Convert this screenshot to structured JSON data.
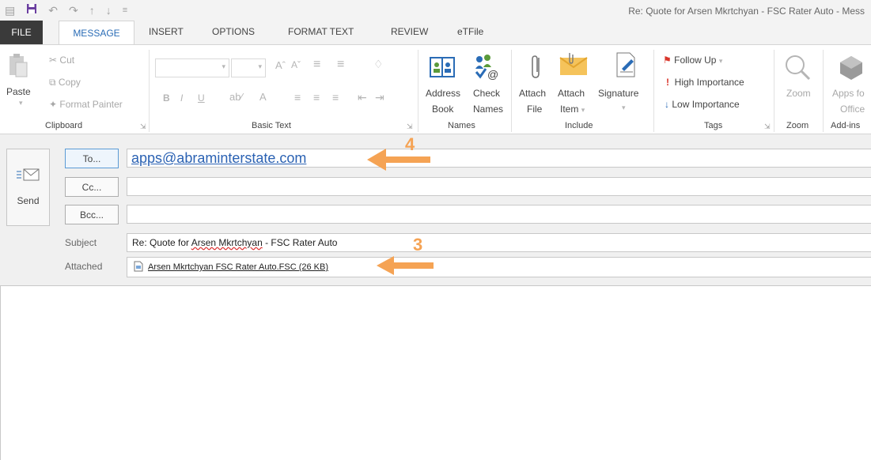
{
  "window": {
    "title": "Re: Quote for Arsen Mkrtchyan - FSC Rater Auto - Mess"
  },
  "tabs": {
    "file": "FILE",
    "message": "MESSAGE",
    "insert": "INSERT",
    "options": "OPTIONS",
    "format_text": "FORMAT TEXT",
    "review": "REVIEW",
    "etfile": "eTFile"
  },
  "ribbon": {
    "clipboard": {
      "paste": "Paste",
      "cut": "Cut",
      "copy": "Copy",
      "format_painter": "Format Painter",
      "label": "Clipboard"
    },
    "basic_text": {
      "label": "Basic Text",
      "bold": "B",
      "italic": "I",
      "underline": "U"
    },
    "names": {
      "address_book_1": "Address",
      "address_book_2": "Book",
      "check_names_1": "Check",
      "check_names_2": "Names",
      "label": "Names"
    },
    "include": {
      "attach_file_1": "Attach",
      "attach_file_2": "File",
      "attach_item_1": "Attach",
      "attach_item_2": "Item",
      "signature": "Signature",
      "label": "Include"
    },
    "tags": {
      "follow_up": "Follow Up",
      "high_importance": "High Importance",
      "low_importance": "Low Importance",
      "label": "Tags"
    },
    "zoom": {
      "zoom": "Zoom",
      "label": "Zoom"
    },
    "addins": {
      "apps_1": "Apps fo",
      "apps_2": "Office",
      "label": "Add-ins"
    }
  },
  "compose": {
    "send": "Send",
    "to_button": "To...",
    "cc_button": "Cc...",
    "bcc_button": "Bcc...",
    "to_value": "apps@abraminterstate.com",
    "subject_label": "Subject",
    "subject_prefix": "Re: Quote for ",
    "subject_misspelled": "Arsen Mkrtchyan",
    "subject_suffix": " - FSC Rater Auto",
    "attached_label": "Attached",
    "attachment": "Arsen Mkrtchyan FSC Rater Auto.FSC (26 KB)"
  },
  "annotations": {
    "arrow_top_number": "4",
    "arrow_bottom_number": "3",
    "color": "#f5a354"
  },
  "colors": {
    "accent": "#2a6cb6",
    "file_tab_bg": "#3a3a3a",
    "save_icon": "#6b3fa0"
  }
}
